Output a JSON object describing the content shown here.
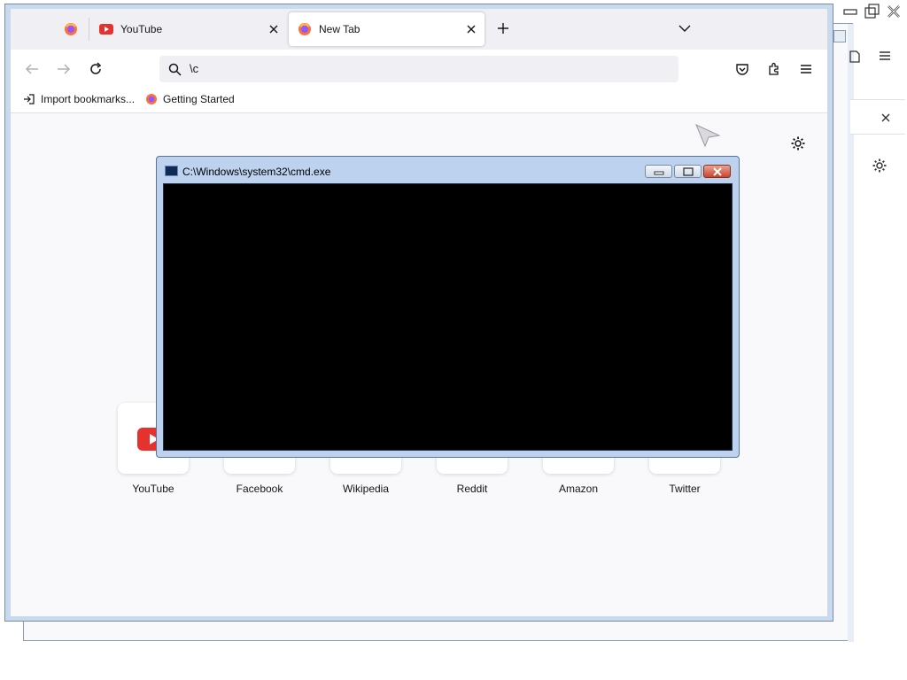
{
  "browser": {
    "tabs": [
      {
        "title": "YouTube",
        "active": false
      },
      {
        "title": "New Tab",
        "active": true
      }
    ],
    "urlbar": {
      "value": "\\c"
    },
    "bookmarks": [
      {
        "label": "Import bookmarks..."
      },
      {
        "label": "Getting Started"
      }
    ],
    "shortcuts": [
      {
        "label": "YouTube"
      },
      {
        "label": "Facebook"
      },
      {
        "label": "Wikipedia"
      },
      {
        "label": "Reddit"
      },
      {
        "label": "Amazon"
      },
      {
        "label": "Twitter"
      }
    ],
    "accent": "#e6322e"
  },
  "cmd": {
    "title": "C:\\Windows\\system32\\cmd.exe",
    "background": "#000000"
  },
  "icons": [
    "firefox-icon",
    "youtube-icon",
    "close-icon",
    "plus-icon",
    "chevron-down-icon",
    "back-icon",
    "forward-icon",
    "reload-icon",
    "search-icon",
    "pocket-icon",
    "extensions-icon",
    "menu-icon",
    "import-icon",
    "gear-icon",
    "cmd-icon"
  ]
}
